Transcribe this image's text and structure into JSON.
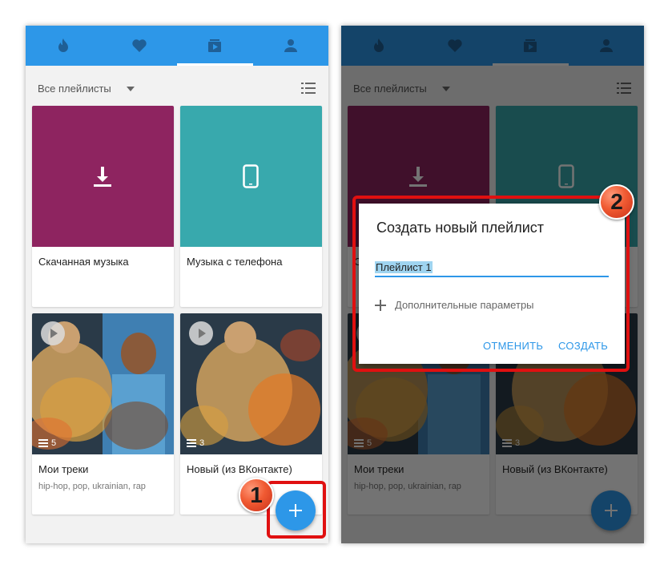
{
  "colors": {
    "topbar": "#2d97e8",
    "accent": "#2d97e8",
    "downloaded_tile": "#8e2460",
    "phone_tile": "#38a9ad",
    "callout_red": "#e01010"
  },
  "tabs": [
    {
      "icon": "fire-icon",
      "active": false
    },
    {
      "icon": "heart-icon",
      "active": false
    },
    {
      "icon": "playlist-play-icon",
      "active": true
    },
    {
      "icon": "person-icon",
      "active": false
    }
  ],
  "filter": {
    "label": "Все плейлисты",
    "dropdown_icon": "chevron-down-icon",
    "view_icon": "list-view-icon"
  },
  "playlists": [
    {
      "title": "Скачанная музыка",
      "subtitle": "",
      "icon": "download-icon"
    },
    {
      "title": "Музыка с телефона",
      "subtitle": "",
      "icon": "phone-icon"
    },
    {
      "title": "Мои треки",
      "subtitle": "hip-hop, pop, ukrainian, rap",
      "track_count": "5",
      "icon": "play-icon"
    },
    {
      "title": "Новый (из ВКонтакте)",
      "subtitle": "",
      "track_count": "3",
      "icon": "play-icon"
    }
  ],
  "fab": {
    "icon": "plus-icon"
  },
  "dialog": {
    "title": "Создать новый плейлист",
    "input_value": "Плейлист 1",
    "more_options": "Дополнительные параметры",
    "cancel": "ОТМЕНИТЬ",
    "create": "СОЗДАТЬ"
  },
  "callouts": {
    "step1": "1",
    "step2": "2"
  }
}
